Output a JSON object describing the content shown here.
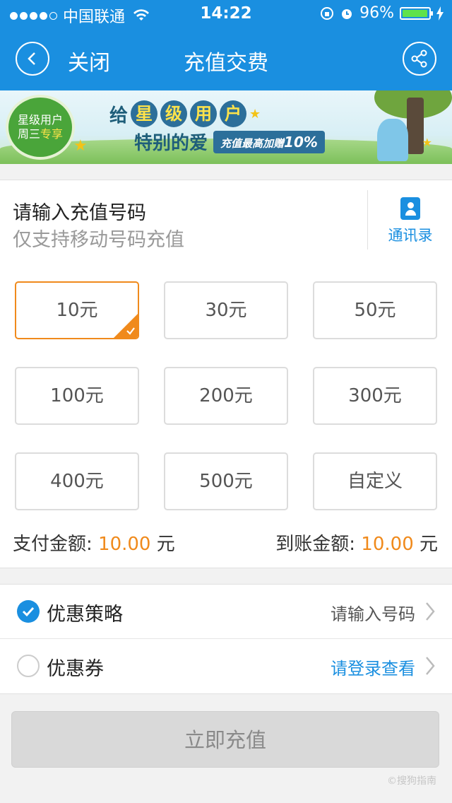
{
  "status_bar": {
    "carrier": "中国联通",
    "time": "14:22",
    "battery": "96%",
    "battery_level": 0.96
  },
  "navbar": {
    "close_label": "关闭",
    "title": "充值交费"
  },
  "banner": {
    "badge_line1": "星级用户",
    "badge_line2_a": "周三",
    "badge_line2_b": "专享",
    "headline_prefix": "给",
    "headline_chars": [
      "星",
      "级",
      "用",
      "户"
    ],
    "subline": "特别的爱",
    "pill_text": "充值最高加赠",
    "pill_value": "10%"
  },
  "phone": {
    "label": "请输入充值号码",
    "placeholder": "仅支持移动号码充值",
    "contacts_label": "通讯录"
  },
  "amounts": {
    "options": [
      "10元",
      "30元",
      "50元",
      "100元",
      "200元",
      "300元",
      "400元",
      "500元",
      "自定义"
    ],
    "selected_index": 0,
    "pay_label": "支付金额: ",
    "pay_value": "10.00",
    "pay_unit": " 元",
    "arrive_label": "到账金额: ",
    "arrive_value": "10.00",
    "arrive_unit": " 元"
  },
  "promo": {
    "strategy_label": "优惠策略",
    "strategy_value": "请输入号码",
    "strategy_checked": true,
    "coupon_label": "优惠券",
    "coupon_value": "请登录查看",
    "coupon_checked": false
  },
  "submit_label": "立即充值",
  "watermark": "©搜狗指南",
  "colors": {
    "primary": "#1a8fe0",
    "accent": "#f08a1c",
    "disabled": "#d9d9d9"
  }
}
